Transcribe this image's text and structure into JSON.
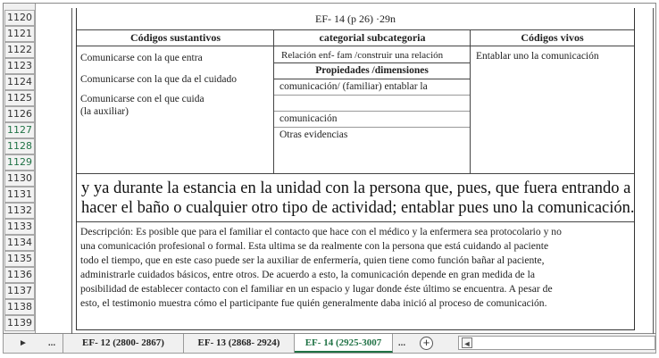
{
  "row_numbers": [
    "1120",
    "1121",
    "1122",
    "1123",
    "1124",
    "1125",
    "1126",
    "1127",
    "1128",
    "1129",
    "1130",
    "1131",
    "1132",
    "1133",
    "1134",
    "1135",
    "1136",
    "1137",
    "1138",
    "1139"
  ],
  "doc": {
    "title": "EF- 14 (p 26) ·29n",
    "headers": {
      "col1": "Códigos sustantivos",
      "col2": "categorial subcategoria",
      "col3": "Códigos vivos"
    },
    "col1_items": [
      "Comunicarse con la que entra",
      "Comunicarse con la que da el cuidado",
      "Comunicarse con el que cuida",
      "(la auxiliar)"
    ],
    "col2_relation": "Relación enf- fam /construir una relación",
    "col2_props_header": "Propiedades /dimensiones",
    "col2_items": [
      "comunicación/ (familiar) entablar la",
      "",
      "comunicación",
      "Otras evidencias"
    ],
    "col3_items": [
      "Entablar uno la comunicación"
    ],
    "quote_lines": [
      "y ya durante la estancia en la unidad con la persona que, pues, que fuera entrando a",
      "hacer el baño o cualquier otro tipo de actividad; entablar pues uno la comunicación."
    ],
    "description_lines": [
      "Descripción: Es posible que para el familiar el contacto que hace con el médico y la enfermera sea protocolario y no",
      "una comunicación profesional o formal. Esta ultima se da realmente con la persona que está cuidando al paciente",
      "todo el tiempo, que en este caso puede ser la auxiliar de enfermería, quien tiene como función bañar al paciente,",
      "administrarle cuidados básicos, entre otros. De acuerdo a esto, la comunicación depende en gran medida de la",
      "posibilidad de establecer contacto con el familiar en un espacio y lugar donde éste último se encuentra. A pesar de",
      "esto, el testimonio muestra cómo el participante fue quién generalmente daba inició al proceso de comunicación."
    ]
  },
  "tabbar": {
    "nav_next": "►",
    "ellipsis_left": "...",
    "tabs": [
      "EF- 12 (2800- 2867)",
      "EF- 13 (2868- 2924)",
      "EF- 14 (2925-3007"
    ],
    "ellipsis_right": "...",
    "add_sheet": "+",
    "scroll_left": "◄"
  },
  "colors": {
    "active_tab": "#217346",
    "row_header_bg": "#f0f0f0"
  }
}
